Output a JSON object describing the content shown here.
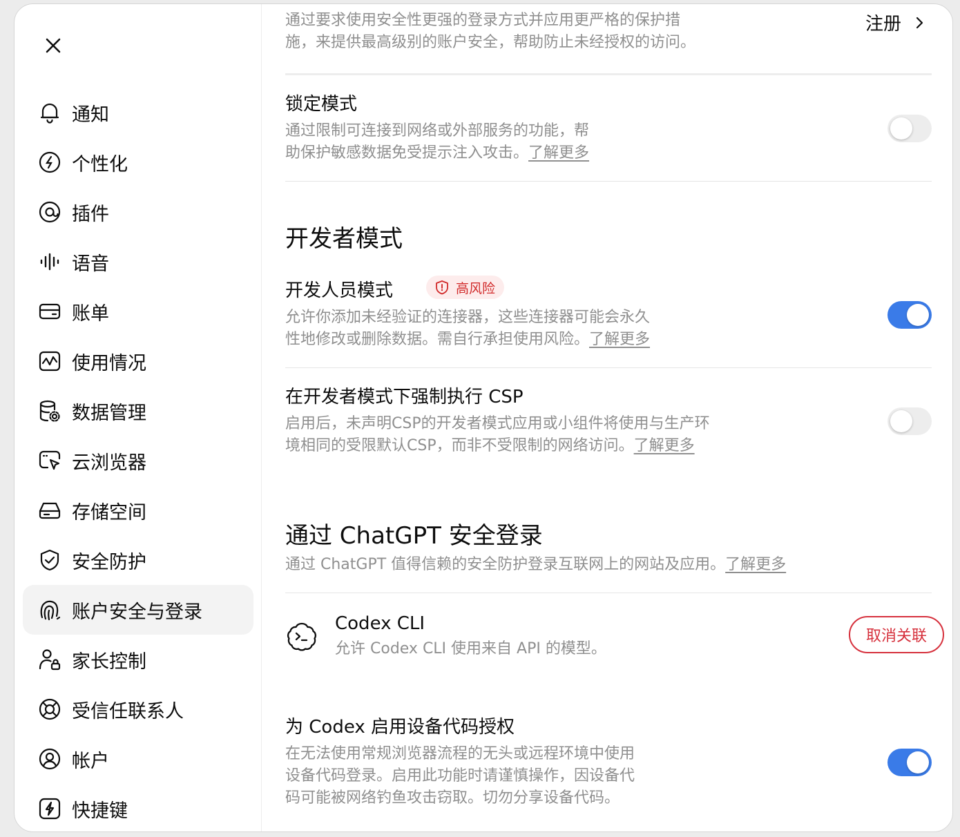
{
  "sidebar": {
    "close_icon": "close-icon",
    "items": [
      {
        "label": "通知",
        "icon": "bell-icon"
      },
      {
        "label": "个性化",
        "icon": "personalize-icon"
      },
      {
        "label": "插件",
        "icon": "plugin-icon"
      },
      {
        "label": "语音",
        "icon": "waveform-icon"
      },
      {
        "label": "账单",
        "icon": "card-icon"
      },
      {
        "label": "使用情况",
        "icon": "usage-chart-icon"
      },
      {
        "label": "数据管理",
        "icon": "database-gear-icon"
      },
      {
        "label": "云浏览器",
        "icon": "browser-cursor-icon"
      },
      {
        "label": "存储空间",
        "icon": "storage-icon"
      },
      {
        "label": "安全防护",
        "icon": "shield-check-icon"
      },
      {
        "label": "账户安全与登录",
        "icon": "fingerprint-icon",
        "active": true
      },
      {
        "label": "家长控制",
        "icon": "parent-lock-icon"
      },
      {
        "label": "受信任联系人",
        "icon": "lifebuoy-icon"
      },
      {
        "label": "帐户",
        "icon": "user-circle-icon"
      },
      {
        "label": "快捷键",
        "icon": "bolt-icon"
      }
    ]
  },
  "main": {
    "advanced_security": {
      "desc_line1": "通过要求使用安全性更强的登录方式并应用更严格的保护措",
      "desc_line2": "施，来提供最高级别的账户安全，帮助防止未经授权的访问。",
      "action_label": "注册"
    },
    "lockdown": {
      "title": "锁定模式",
      "desc_line1": "通过限制可连接到网络或外部服务的功能，帮",
      "desc_line2": "助保护敏感数据免受提示注入攻击。",
      "link": "了解更多",
      "enabled": false
    },
    "developer_section_title": "开发者模式",
    "developer_mode": {
      "title": "开发人员模式",
      "badge": "高风险",
      "desc_line1": "允许你添加未经验证的连接器，这些连接器可能会永久",
      "desc_line2": "性地修改或删除数据。需自行承担使用风险。",
      "link": "了解更多",
      "enabled": true
    },
    "csp": {
      "title": "在开发者模式下强制执行 CSP",
      "desc_line1": "启用后，未声明CSP的开发者模式应用或小组件将使用与生产环",
      "desc_line2": "境相同的受限默认CSP，而非不受限制的网络访问。",
      "link": "了解更多",
      "enabled": false
    },
    "chatgpt_login": {
      "title": "通过 ChatGPT 安全登录",
      "desc": "通过 ChatGPT 值得信赖的安全防护登录互联网上的网站及应用。",
      "link": "了解更多"
    },
    "codex_cli": {
      "icon": "codex-cli-icon",
      "title": "Codex CLI",
      "desc": "允许 Codex CLI 使用来自 API 的模型。",
      "button": "取消关联"
    },
    "device_code": {
      "title": "为 Codex 启用设备代码授权",
      "desc_line1": "在无法使用常规浏览器流程的无头或远程环境中使用",
      "desc_line2": "设备代码登录。启用此功能时请谨慎操作，因设备代",
      "desc_line3": "码可能被网络钓鱼攻击窃取。切勿分享设备代码。",
      "enabled": true
    }
  },
  "colors": {
    "accent_blue": "#3a7be8",
    "danger_red": "#d6303c",
    "muted_text": "#8f8f8f"
  }
}
